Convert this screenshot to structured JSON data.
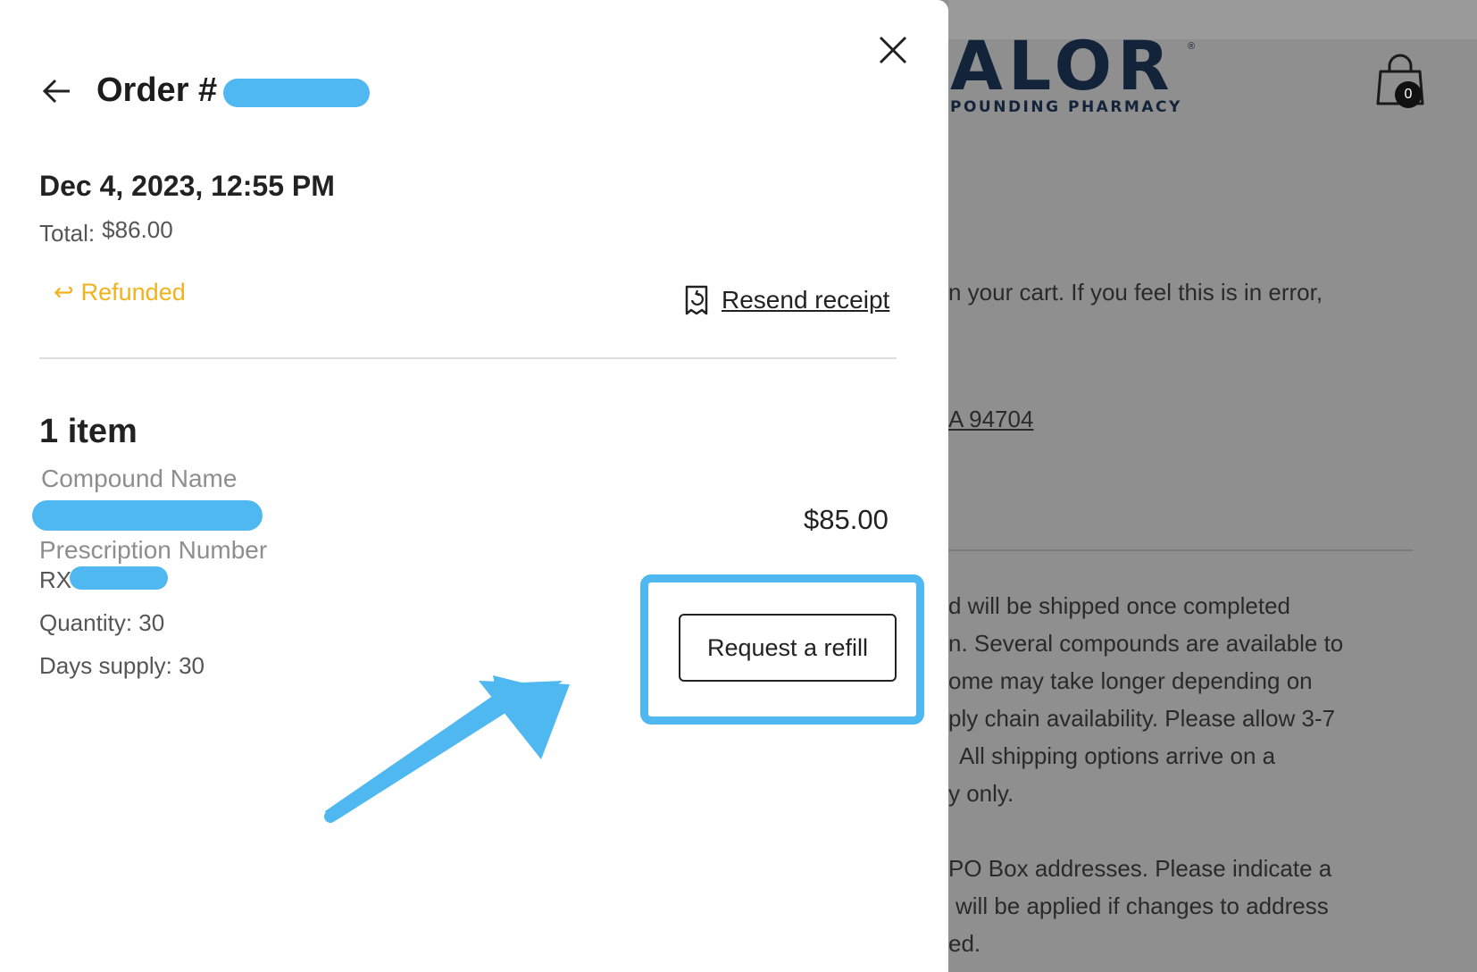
{
  "background": {
    "brand_letters": "ALOR",
    "brand_reg": "®",
    "brand_tagline": "POUNDING PHARMACY",
    "cart_count": "0",
    "cart_icon": "shopping-bag-icon",
    "lines": [
      "n your cart. If you feel this is in error,",
      "A 94704",
      "d will be shipped once completed",
      "n. Several compounds are available to",
      "ome may take longer depending on",
      "ply chain availability. Please allow 3-7",
      "All shipping options arrive on a",
      "y only.",
      "PO Box addresses. Please indicate a",
      "will be applied if changes to address",
      "ed."
    ]
  },
  "drawer": {
    "back_icon": "arrow-left-icon",
    "close_icon": "close-icon",
    "order_title": "Order #",
    "order_date": "Dec 4, 2023, 12:55 PM",
    "total_label": "Total:",
    "total_value": "$86.00",
    "status_icon": "return-arrow-icon",
    "status_glyph": "↩",
    "status_label": "Refunded",
    "resend_icon": "receipt-icon",
    "resend_label": "Resend receipt",
    "items_count": "1 item",
    "compound_label": "Compound Name",
    "prescription_label": "Prescription Number",
    "prescription_prefix": "RX",
    "quantity": "Quantity: 30",
    "days_supply": "Days supply: 30",
    "line_price": "$85.00",
    "refill_button": "Request a refill"
  },
  "colors": {
    "highlight": "#4fb8f0",
    "refund_status": "#f3b21c",
    "overlay": "#8f8f8f",
    "brand_navy": "#13243a"
  }
}
